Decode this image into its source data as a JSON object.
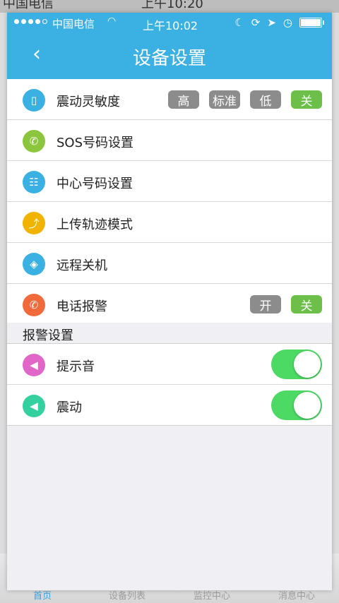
{
  "background": {
    "status": {
      "carrier": "中国电信",
      "time": "上午10:20"
    },
    "tabs": [
      {
        "label": "首页",
        "active": true
      },
      {
        "label": "设备列表",
        "active": false
      },
      {
        "label": "监控中心",
        "active": false
      },
      {
        "label": "消息中心",
        "active": false
      }
    ]
  },
  "status_bar": {
    "carrier": "中国电信",
    "time": "上午10:02"
  },
  "header": {
    "back_symbol": "‹",
    "title": "设备设置"
  },
  "colors": {
    "header": "#3ab0e3",
    "pill_inactive": "#8c8c8c",
    "pill_active": "#6cc04a",
    "toggle_on": "#4cd964"
  },
  "settings": [
    {
      "label": "震动灵敏度",
      "icon": "phone-vibrate-icon",
      "icon_color": "#3ab0e3",
      "icon_glyph": "▯",
      "options": [
        "高",
        "标准",
        "低",
        "关"
      ],
      "selected": 3
    },
    {
      "label": "SOS号码设置",
      "icon": "phone-sos-icon",
      "icon_color": "#8cc63f",
      "icon_glyph": "✆"
    },
    {
      "label": "中心号码设置",
      "icon": "dialpad-icon",
      "icon_color": "#3ab0e3",
      "icon_glyph": "☷"
    },
    {
      "label": "上传轨迹模式",
      "icon": "upload-arrow-icon",
      "icon_color": "#f0b400",
      "icon_glyph": "⤴"
    },
    {
      "label": "远程关机",
      "icon": "remote-shutdown-icon",
      "icon_color": "#3ab0e3",
      "icon_glyph": "◈"
    },
    {
      "label": "电话报警",
      "icon": "phone-alarm-icon",
      "icon_color": "#f06a3c",
      "icon_glyph": "✆",
      "options": [
        "开",
        "关"
      ],
      "selected": 1
    }
  ],
  "alarm_section": {
    "title": "报警设置",
    "items": [
      {
        "label": "提示音",
        "icon": "speaker-icon",
        "icon_color": "#e066c8",
        "icon_glyph": "◀",
        "on": true
      },
      {
        "label": "震动",
        "icon": "vibrate-icon",
        "icon_color": "#35d0a0",
        "icon_glyph": "◀",
        "on": true
      }
    ]
  }
}
